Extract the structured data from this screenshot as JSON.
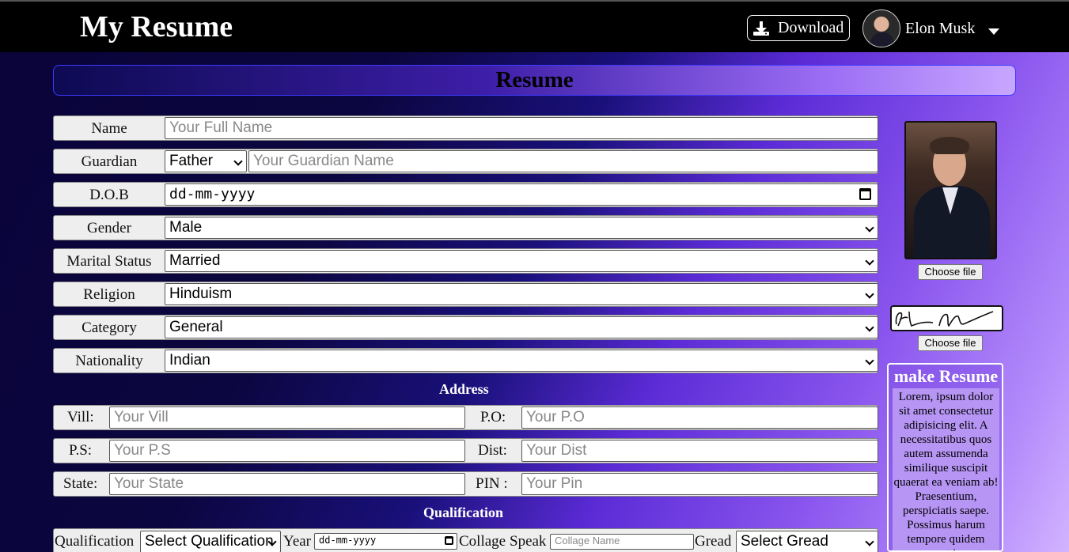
{
  "header": {
    "logo": "My Resume",
    "download_label": "Download",
    "user_name": "Elon Musk"
  },
  "page_title": "Resume",
  "form": {
    "name_label": "Name",
    "name_placeholder": "Your Full Name",
    "guardian_label": "Guardian",
    "guardian_relation": "Father",
    "guardian_placeholder": "Your Guardian Name",
    "dob_label": "D.O.B",
    "dob_value": "dd-mm-yyyy",
    "gender_label": "Gender",
    "gender_value": "Male",
    "marital_label": "Marital Status",
    "marital_value": "Married",
    "religion_label": "Religion",
    "religion_value": "Hinduism",
    "category_label": "Category",
    "category_value": "General",
    "nationality_label": "Nationality",
    "nationality_value": "Indian"
  },
  "address": {
    "title": "Address",
    "vill_label": "Vill:",
    "vill_placeholder": "Your Vill",
    "po_label": "P.O:",
    "po_placeholder": "Your P.O",
    "ps_label": "P.S:",
    "ps_placeholder": "Your P.S",
    "dist_label": "Dist:",
    "dist_placeholder": "Your Dist",
    "state_label": "State:",
    "state_placeholder": "Your State",
    "pin_label": "PIN :",
    "pin_placeholder": "Your Pin"
  },
  "qualification": {
    "title": "Qualification",
    "qual_label": "Qualification",
    "qual_value": "Select Qualification",
    "year_label": "Year",
    "year_value": "dd-mm-yyyy",
    "collage_label": "Collage",
    "speak_label": "Speak",
    "collage_placeholder": "Collage Name",
    "gread_label": "Gread",
    "gread_value": "Select Gread"
  },
  "sidebar": {
    "photo_choose": "Choose file",
    "sig_choose": "Choose file",
    "card_title": "make Resume",
    "card_text": "Lorem, ipsum dolor sit amet consectetur adipisicing elit. A necessitatibus quos autem assumenda similique suscipit quaerat ea veniam ab! Praesentium, perspiciatis saepe. Possimus harum tempore quidem earum amet inventore"
  }
}
